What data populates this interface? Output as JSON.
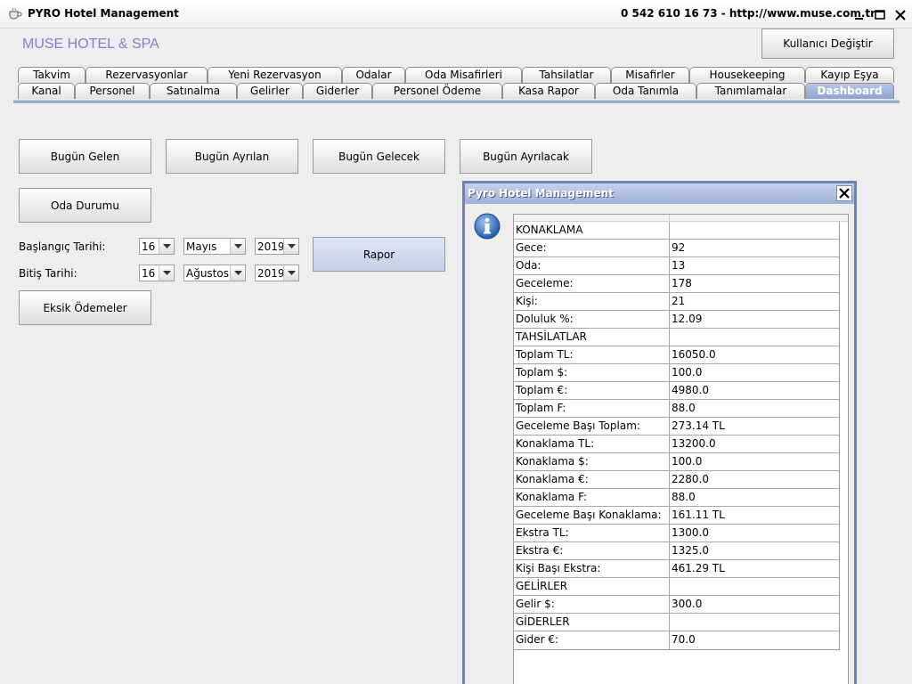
{
  "window": {
    "title": "PYRO Hotel Management",
    "contact": "0 542 610 16 73  -  http://www.muse.com.tr"
  },
  "header": {
    "hotel_name": "MUSE HOTEL & SPA",
    "user_switch_label": "Kullanıcı Değiştir"
  },
  "tabs": {
    "row1": [
      "Takvim",
      "Rezervasyonlar",
      "Yeni Rezervasyon",
      "Odalar",
      "Oda Misafirleri",
      "Tahsilatlar",
      "Misafirler",
      "Housekeeping",
      "Kayıp Eşya"
    ],
    "row2": [
      "Kanal",
      "Personel",
      "Satınalma",
      "Gelirler",
      "Giderler",
      "Personel Ödeme",
      "Kasa Rapor",
      "Oda Tanımla",
      "Tanımlamalar",
      "Dashboard"
    ],
    "active": "Dashboard"
  },
  "dashboard": {
    "btn_bugun_gelen": "Bugün Gelen",
    "btn_bugun_ayrilan": "Bugün Ayrılan",
    "btn_bugun_gelecek": "Bugün Gelecek",
    "btn_bugun_ayrilacak": "Bugün Ayrılacak",
    "btn_oda_durumu": "Oda Durumu",
    "start_label": "Başlangıç Tarihi:",
    "end_label": "Bitiş Tarihi:",
    "start_day": "16",
    "start_month": "Mayıs",
    "start_year": "2019",
    "end_day": "16",
    "end_month": "Ağustos",
    "end_year": "2019",
    "btn_rapor": "Rapor",
    "btn_eksik_odemeler": "Eksik Ödemeler"
  },
  "dialog": {
    "title": "Pyro Hotel Management",
    "rows": [
      [
        "KONAKLAMA",
        ""
      ],
      [
        "Gece:",
        "92"
      ],
      [
        "Oda:",
        "13"
      ],
      [
        "Geceleme:",
        "178"
      ],
      [
        "Kişi:",
        "21"
      ],
      [
        "Doluluk %:",
        "12.09"
      ],
      [
        "TAHSİLATLAR",
        ""
      ],
      [
        "Toplam TL:",
        "16050.0"
      ],
      [
        "Toplam $:",
        "100.0"
      ],
      [
        "Toplam €:",
        "4980.0"
      ],
      [
        "Toplam F:",
        "88.0"
      ],
      [
        "Geceleme Başı Toplam:",
        "273.14 TL"
      ],
      [
        "Konaklama TL:",
        "13200.0"
      ],
      [
        "Konaklama $:",
        "100.0"
      ],
      [
        "Konaklama €:",
        "2280.0"
      ],
      [
        "Konaklama F:",
        "88.0"
      ],
      [
        "Geceleme Başı Konaklama:",
        "161.11 TL"
      ],
      [
        "Ekstra TL:",
        "1300.0"
      ],
      [
        "Ekstra €:",
        "1325.0"
      ],
      [
        "Kişi Başı Ekstra:",
        "461.29 TL"
      ],
      [
        "GELİRLER",
        ""
      ],
      [
        "Gelir $:",
        "300.0"
      ],
      [
        "GİDERLER",
        ""
      ],
      [
        "Gider €:",
        "70.0"
      ]
    ]
  },
  "colors": {
    "accent": "#7b83c9",
    "dialog_border": "#6e82b5",
    "active_tab": "#8ea3d1"
  }
}
